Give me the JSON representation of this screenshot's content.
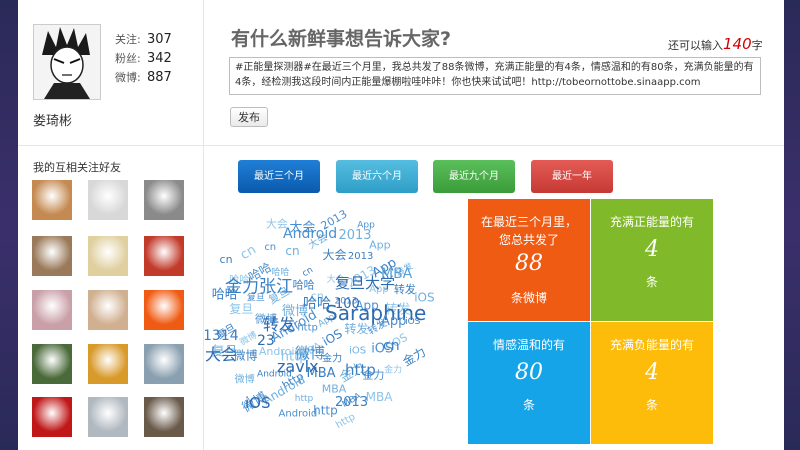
{
  "profile": {
    "stats": [
      {
        "label": "关注:",
        "value": "307"
      },
      {
        "label": "粉丝:",
        "value": "342"
      },
      {
        "label": "微博:",
        "value": "887"
      }
    ],
    "username": "娄琦彬"
  },
  "compose": {
    "prompt": "有什么新鲜事想告诉大家?",
    "remaining_prefix": "还可以输入",
    "remaining_count": "140",
    "remaining_suffix": "字",
    "text": "#正能量探测器#在最近三个月里，我总共发了88条微博，充满正能量的有4条，情感温和的有80条，充满负能量的有4条，经检测我这段时间内正能量爆棚啦哇咔咔！你也快来试试吧！http://tobeornottobe.sinaapp.com",
    "post_label": "发布"
  },
  "friends": {
    "title": "我的互相关注好友",
    "colors": [
      "#c58a52",
      "#d8d8d8",
      "#8a8a8a",
      "#9a7a5a",
      "#e0d0a0",
      "#c23a2a",
      "#caa0a8",
      "#d0b090",
      "#f05b13",
      "#4a6a3a",
      "#d89a2a",
      "#8aa0b0",
      "#c01818",
      "#b0b8c0",
      "#6a5a4a"
    ]
  },
  "range_buttons": [
    "最近三个月",
    "最近六个月",
    "最近九个月",
    "最近一年"
  ],
  "word_cloud": {
    "words": [
      {
        "text": "Saraphine",
        "color": "#2d6bb0"
      },
      {
        "text": "复旦大学",
        "color": "#2d6bb0"
      },
      {
        "text": "金力张江",
        "color": "#3a7fc2"
      },
      {
        "text": "哈哈",
        "color": "#3a7fc2"
      },
      {
        "text": "转发",
        "color": "#2d6bb0"
      },
      {
        "text": "微博",
        "color": "#4a8fd0"
      },
      {
        "text": "zavlx",
        "color": "#2d6bb0"
      },
      {
        "text": "http",
        "color": "#3a7fc2"
      },
      {
        "text": "iOS",
        "color": "#2d6bb0"
      },
      {
        "text": "MBA",
        "color": "#5aa0d8"
      },
      {
        "text": "Android",
        "color": "#4a8fd0"
      },
      {
        "text": "2013",
        "color": "#3a7fc2"
      },
      {
        "text": "大会",
        "color": "#2d6bb0"
      },
      {
        "text": "cn",
        "color": "#3a7fc2"
      },
      {
        "text": "App",
        "color": "#4a8fd0"
      },
      {
        "text": "100",
        "color": "#2d6bb0"
      },
      {
        "text": "23",
        "color": "#2d6bb0"
      },
      {
        "text": "1314",
        "color": "#3a7fc2"
      }
    ]
  },
  "tiles": [
    {
      "caption": "在最近三个月里，您总共发了",
      "value": "88",
      "unit": "条微博",
      "color": "#f05b13"
    },
    {
      "caption": "充满正能量的有",
      "value": "4",
      "unit": "条",
      "color": "#80ba2a"
    },
    {
      "caption": "情感温和的有",
      "value": "80",
      "unit": "条",
      "color": "#15a4e8"
    },
    {
      "caption": "充满负能量的有",
      "value": "4",
      "unit": "条",
      "color": "#fdbc09"
    }
  ]
}
